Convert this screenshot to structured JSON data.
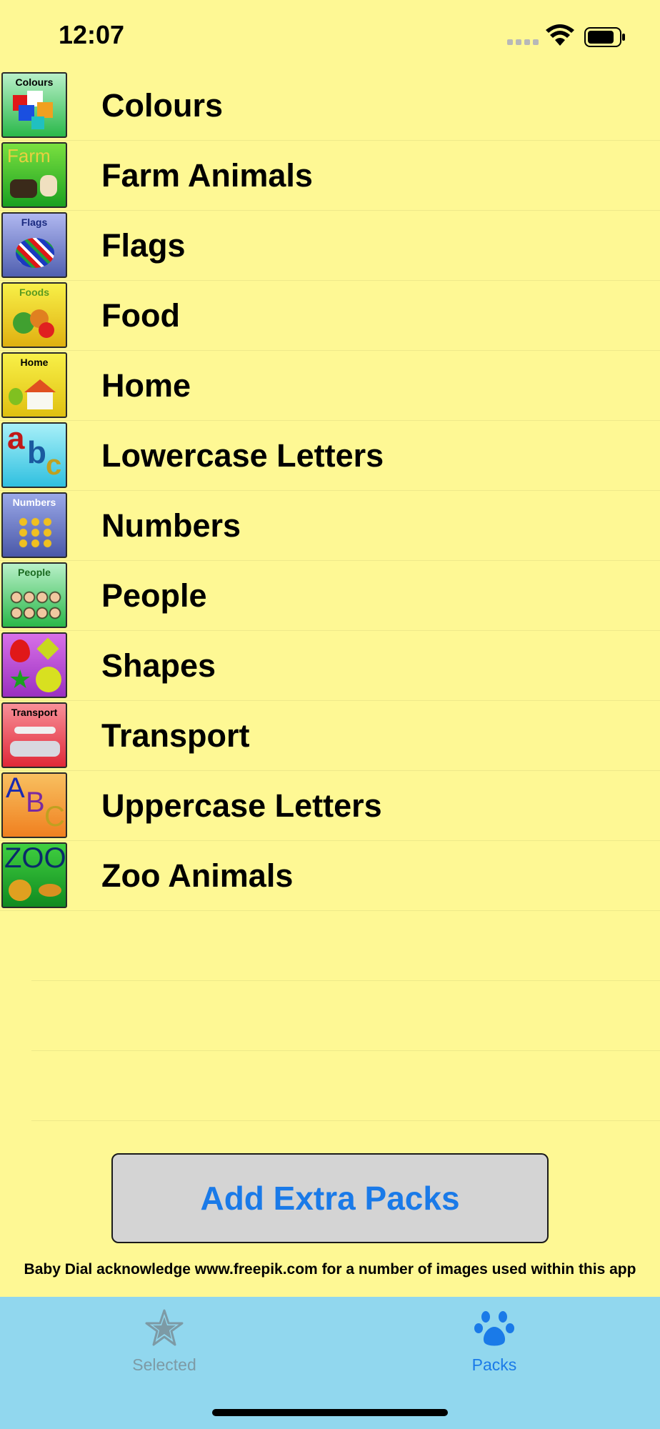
{
  "status_bar": {
    "time": "12:07",
    "icons": [
      "signal-icon",
      "wifi-icon",
      "battery-icon"
    ]
  },
  "packs": [
    {
      "label": "Colours",
      "icon_caption": "Colours",
      "icon": "colours-pack-icon"
    },
    {
      "label": "Farm Animals",
      "icon_caption": "Farm",
      "icon": "farm-pack-icon"
    },
    {
      "label": "Flags",
      "icon_caption": "Flags",
      "icon": "flags-pack-icon"
    },
    {
      "label": "Food",
      "icon_caption": "Foods",
      "icon": "food-pack-icon"
    },
    {
      "label": "Home",
      "icon_caption": "Home",
      "icon": "home-pack-icon"
    },
    {
      "label": "Lowercase Letters",
      "icon_caption": "abc",
      "icon": "lowercase-pack-icon"
    },
    {
      "label": "Numbers",
      "icon_caption": "Numbers",
      "icon": "numbers-pack-icon"
    },
    {
      "label": "People",
      "icon_caption": "People",
      "icon": "people-pack-icon"
    },
    {
      "label": "Shapes",
      "icon_caption": "",
      "icon": "shapes-pack-icon"
    },
    {
      "label": "Transport",
      "icon_caption": "Transport",
      "icon": "transport-pack-icon"
    },
    {
      "label": "Uppercase Letters",
      "icon_caption": "ABC",
      "icon": "uppercase-pack-icon"
    },
    {
      "label": "Zoo Animals",
      "icon_caption": "ZOO",
      "icon": "zoo-pack-icon"
    }
  ],
  "add_button_label": "Add Extra Packs",
  "acknowledgement": "Baby Dial acknowledge www.freepik.com for a number of images used within this app",
  "tabs": [
    {
      "label": "Selected",
      "icon": "star-icon",
      "active": false
    },
    {
      "label": "Packs",
      "icon": "paw-icon",
      "active": true
    }
  ],
  "colors": {
    "background": "#fef894",
    "tab_bar": "#91d7ee",
    "accent": "#1a7ae8",
    "button": "#d4d4d4"
  }
}
